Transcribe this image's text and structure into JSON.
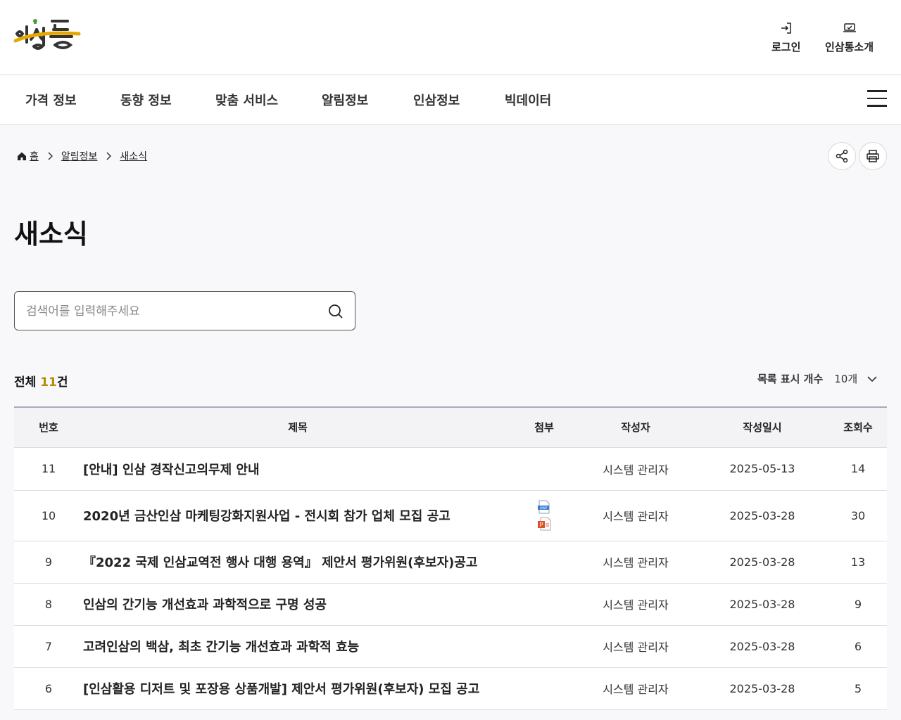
{
  "header": {
    "logo_alt": "인삼통",
    "login_label": "로그인",
    "intro_label": "인삼통소개"
  },
  "gnb": [
    "가격 정보",
    "동향 정보",
    "맞춤 서비스",
    "알림정보",
    "인삼정보",
    "빅데이터"
  ],
  "breadcrumb": {
    "home": "홈",
    "level1": "알림정보",
    "level2": "새소식"
  },
  "page_title": "새소식",
  "search": {
    "placeholder": "검색어를 입력해주세요",
    "value": ""
  },
  "summary": {
    "prefix": "전체 ",
    "count": "11",
    "suffix": "건"
  },
  "list_size": {
    "label": "목록 표시 개수",
    "value": "10개"
  },
  "table": {
    "headers": [
      "번호",
      "제목",
      "첨부",
      "작성자",
      "작성일시",
      "조회수"
    ],
    "rows": [
      {
        "no": "11",
        "title": "[안내] 인삼 경작신고의무제 안내",
        "attach": [],
        "author": "시스템 관리자",
        "date": "2025-05-13",
        "views": "14"
      },
      {
        "no": "10",
        "title": "2020년 금산인삼 마케팅강화지원사업 - 전시회 참가 업체 모집 공고",
        "attach": [
          "hwp",
          "ppt"
        ],
        "author": "시스템 관리자",
        "date": "2025-03-28",
        "views": "30"
      },
      {
        "no": "9",
        "title": "『2022 국제 인삼교역전 행사 대행 용역』 제안서 평가위원(후보자)공고",
        "attach": [],
        "author": "시스템 관리자",
        "date": "2025-03-28",
        "views": "13"
      },
      {
        "no": "8",
        "title": "인삼의 간기능 개선효과 과학적으로 구명 성공",
        "attach": [],
        "author": "시스템 관리자",
        "date": "2025-03-28",
        "views": "9"
      },
      {
        "no": "7",
        "title": "고려인삼의 백삼, 최초 간기능 개선효과 과학적 효능",
        "attach": [],
        "author": "시스템 관리자",
        "date": "2025-03-28",
        "views": "6"
      },
      {
        "no": "6",
        "title": "[인삼활용 디저트 및 포장용 상품개발] 제안서 평가위원(후보자) 모집 공고",
        "attach": [],
        "author": "시스템 관리자",
        "date": "2025-03-28",
        "views": "5"
      }
    ]
  },
  "colors": {
    "accent_count": "#b48c00",
    "table_top_border": "#a8a8c0"
  },
  "icons": {
    "login": "login-icon",
    "intro": "laptop-icon",
    "share": "share-icon",
    "print": "print-icon",
    "search": "search-icon",
    "home": "home-icon",
    "menu": "hamburger-menu-icon"
  }
}
